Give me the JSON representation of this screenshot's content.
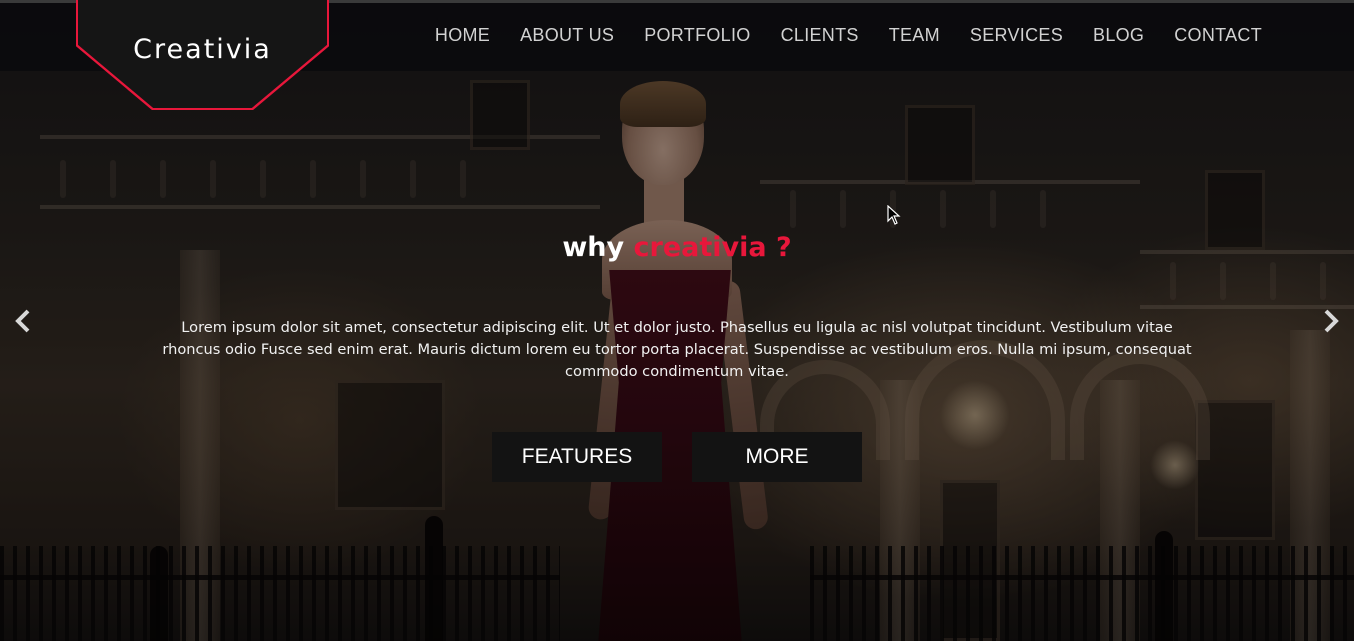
{
  "brand": {
    "logo_text": "Creativia",
    "accent_color": "#e8173b"
  },
  "nav": {
    "items": [
      "HOME",
      "ABOUT US",
      "PORTFOLIO",
      "CLIENTS",
      "TEAM",
      "SERVICES",
      "BLOG",
      "CONTACT"
    ]
  },
  "hero": {
    "headline_prefix": "why",
    "headline_accent": "creativia ?",
    "body": "Lorem ipsum dolor sit amet, consectetur adipiscing elit. Ut et dolor justo. Phasellus eu ligula ac nisl volutpat tincidunt. Vestibulum vitae rhoncus odio Fusce sed enim erat. Mauris dictum lorem eu tortor porta placerat. Suspendisse ac vestibulum eros. Nulla mi ipsum, consequat commodo condimentum vitae.",
    "buttons": {
      "features": "FEATURES",
      "more": "MORE"
    }
  },
  "carousel": {
    "prev_icon": "chevron-left-icon",
    "next_icon": "chevron-right-icon"
  }
}
